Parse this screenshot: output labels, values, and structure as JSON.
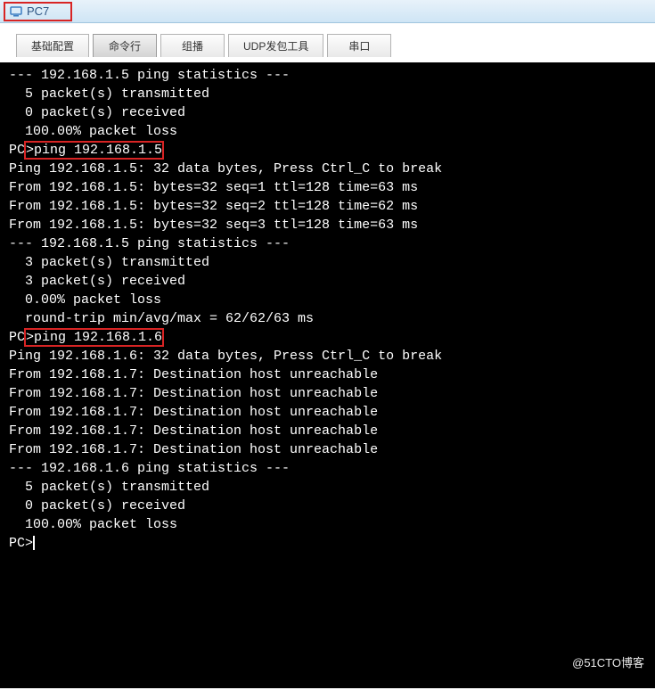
{
  "window": {
    "title": "PC7"
  },
  "tabs": {
    "t0": "基础配置",
    "t1": "命令行",
    "t2": "组播",
    "t3": "UDP发包工具",
    "t4": "串口"
  },
  "terminal": {
    "line01": "--- 192.168.1.5 ping statistics ---",
    "line02": "  5 packet(s) transmitted",
    "line03": "  0 packet(s) received",
    "line04": "  100.00% packet loss",
    "line05": "",
    "prompt1_pre": "PC",
    "prompt1_cmd": ">ping 192.168.1.5",
    "line07": "",
    "line08": "Ping 192.168.1.5: 32 data bytes, Press Ctrl_C to break",
    "line09": "From 192.168.1.5: bytes=32 seq=1 ttl=128 time=63 ms",
    "line10": "From 192.168.1.5: bytes=32 seq=2 ttl=128 time=62 ms",
    "line11": "From 192.168.1.5: bytes=32 seq=3 ttl=128 time=63 ms",
    "line12": "",
    "line13": "--- 192.168.1.5 ping statistics ---",
    "line14": "  3 packet(s) transmitted",
    "line15": "  3 packet(s) received",
    "line16": "  0.00% packet loss",
    "line17": "  round-trip min/avg/max = 62/62/63 ms",
    "line18": "",
    "prompt2_pre": "PC",
    "prompt2_cmd": ">ping 192.168.1.6",
    "line20": "",
    "line21": "Ping 192.168.1.6: 32 data bytes, Press Ctrl_C to break",
    "line22": "From 192.168.1.7: Destination host unreachable",
    "line23": "From 192.168.1.7: Destination host unreachable",
    "line24": "From 192.168.1.7: Destination host unreachable",
    "line25": "From 192.168.1.7: Destination host unreachable",
    "line26": "From 192.168.1.7: Destination host unreachable",
    "line27": "",
    "line28": "--- 192.168.1.6 ping statistics ---",
    "line29": "  5 packet(s) transmitted",
    "line30": "  0 packet(s) received",
    "line31": "  100.00% packet loss",
    "line32": "",
    "prompt3": "PC>"
  },
  "watermark": "@51CTO博客"
}
